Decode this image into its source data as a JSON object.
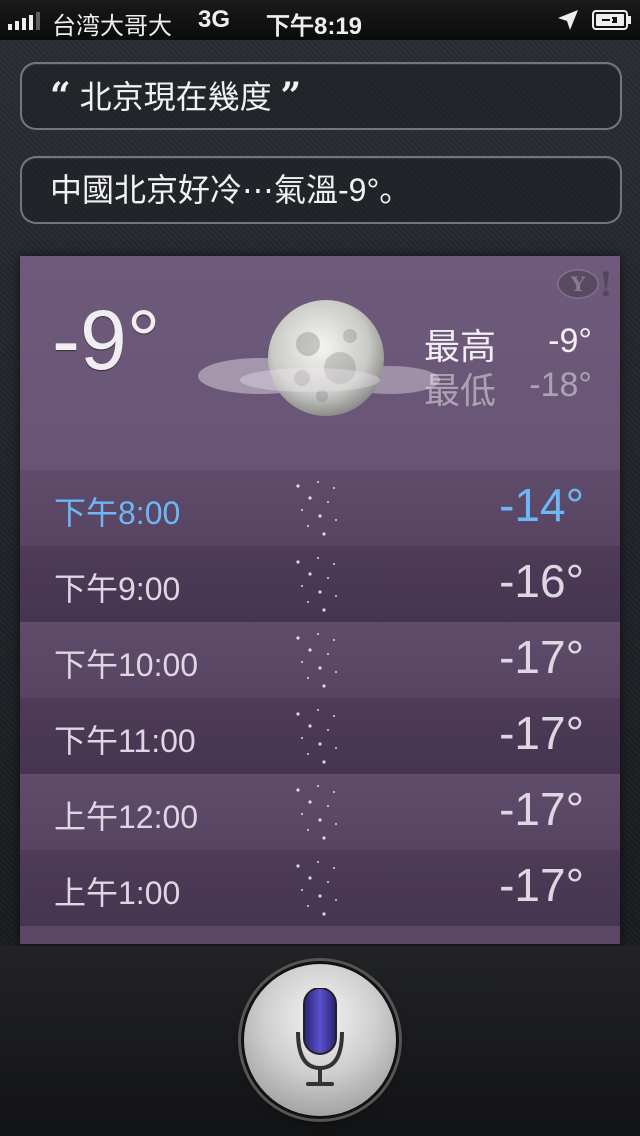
{
  "status_bar": {
    "carrier": "台湾大哥大",
    "network": "3G",
    "time": "下午8:19"
  },
  "conversation": {
    "question": "北京現在幾度",
    "open_quote": "“",
    "close_quote": "”",
    "answer": "中國北京好冷⋯氣溫-9°。"
  },
  "weather": {
    "current_temp": "-9°",
    "high_label": "最高",
    "high_value": "-9°",
    "low_label": "最低",
    "low_value": "-18°",
    "hourly": [
      {
        "time": "下午8:00",
        "temp": "-14°",
        "current": true
      },
      {
        "time": "下午9:00",
        "temp": "-16°",
        "current": false
      },
      {
        "time": "下午10:00",
        "temp": "-17°",
        "current": false
      },
      {
        "time": "下午11:00",
        "temp": "-17°",
        "current": false
      },
      {
        "time": "上午12:00",
        "temp": "-17°",
        "current": false
      },
      {
        "time": "上午1:00",
        "temp": "-17°",
        "current": false
      }
    ]
  },
  "icons": {
    "location": "location-arrow-icon",
    "battery": "battery-charging-icon",
    "weather": "moon-cloud-icon",
    "hourly": "night-stars-icon",
    "brand": "yahoo-icon",
    "mic": "microphone-icon"
  },
  "colors": {
    "card": "#5b4766",
    "current_hour": "#6eb6f5",
    "mic_accent": "#4b3fb8"
  }
}
